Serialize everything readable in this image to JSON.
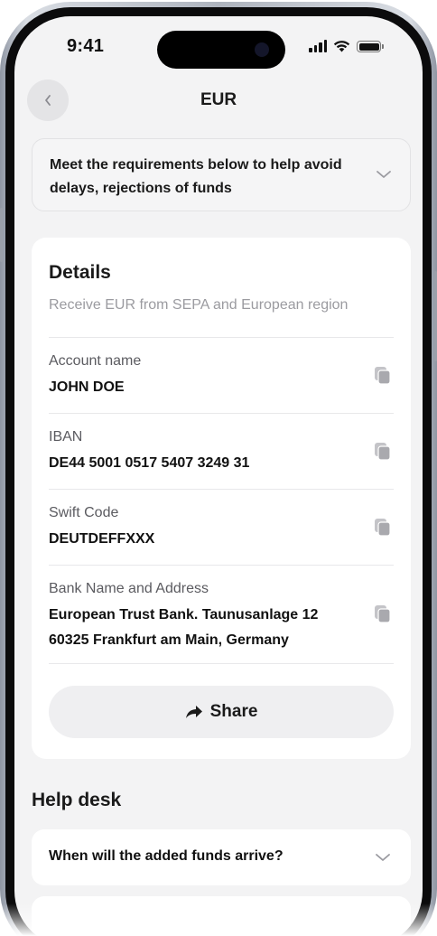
{
  "status_bar": {
    "time": "9:41",
    "icons": [
      "cellular-signal-icon",
      "wifi-icon",
      "battery-icon"
    ]
  },
  "header": {
    "back_icon": "chevron-left-icon",
    "title": "EUR"
  },
  "requirements_banner": {
    "text": "Meet the requirements below to help avoid delays, rejections of funds",
    "icon": "chevron-down-icon"
  },
  "details": {
    "title": "Details",
    "subtitle": "Receive EUR from SEPA and European region",
    "fields": [
      {
        "label": "Account name",
        "value": "JOHN DOE",
        "icon": "copy-icon"
      },
      {
        "label": "IBAN",
        "value": "DE44 5001 0517 5407 3249 31",
        "icon": "copy-icon"
      },
      {
        "label": "Swift Code",
        "value": "DEUTDEFFXXX",
        "icon": "copy-icon"
      },
      {
        "label": "Bank Name and Address",
        "value": "European Trust Bank. Taunusanlage 12 60325 Frankfurt am Main, Germany",
        "icon": "copy-icon"
      }
    ],
    "share_button": {
      "label": "Share",
      "icon": "share-arrow-icon"
    }
  },
  "help_desk": {
    "title": "Help desk",
    "items": [
      {
        "question": "When will the added funds arrive?",
        "icon": "chevron-down-icon"
      }
    ]
  },
  "colors": {
    "background": "#f3f3f4",
    "card": "#ffffff",
    "text_primary": "#111111",
    "text_secondary": "#9b9ba0",
    "button_bg": "#efeff1"
  }
}
